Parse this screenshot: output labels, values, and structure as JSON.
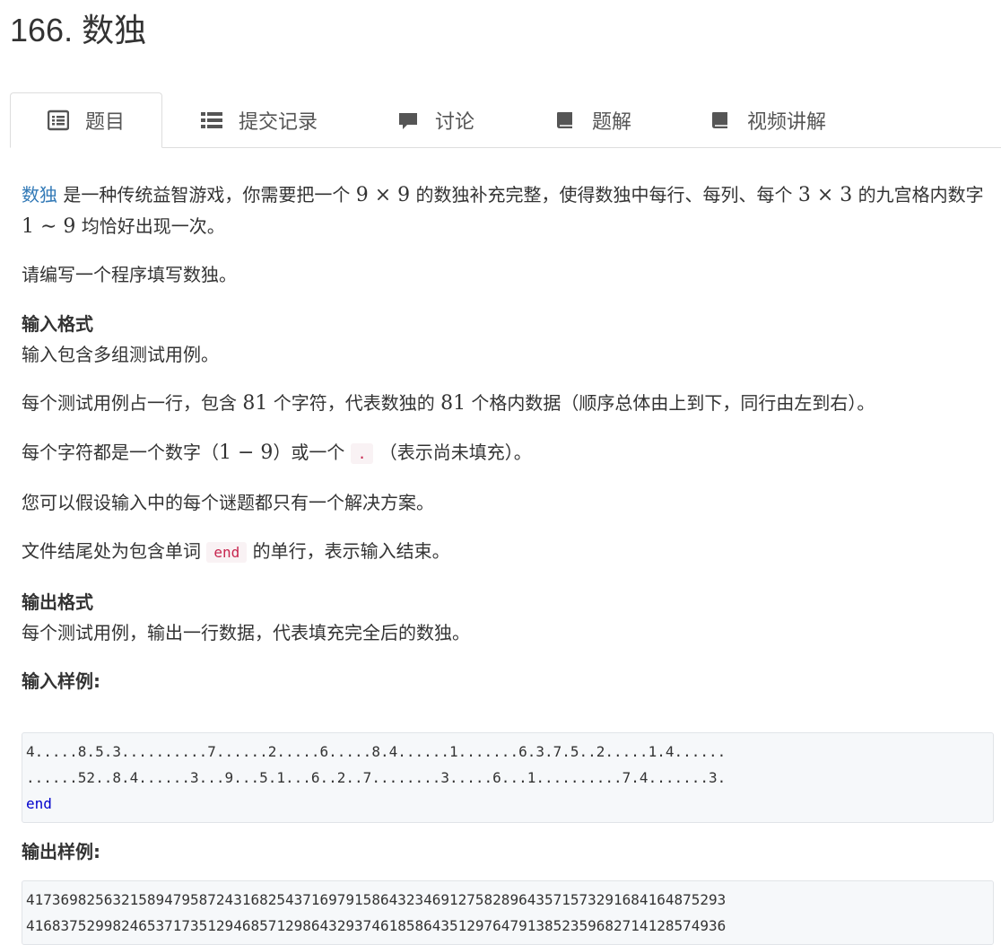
{
  "problem": {
    "title": "166. 数独"
  },
  "tabs": [
    {
      "label": "题目",
      "icon": "list-alt-icon",
      "active": true
    },
    {
      "label": "提交记录",
      "icon": "list-icon"
    },
    {
      "label": "讨论",
      "icon": "comment-icon"
    },
    {
      "label": "题解",
      "icon": "book-icon"
    },
    {
      "label": "视频讲解",
      "icon": "book-icon"
    }
  ],
  "intro": {
    "link": "数独",
    "t1": " 是一种传统益智游戏，你需要把一个 ",
    "m1": "9 × 9",
    "t2": " 的数独补充完整，使得数独中每行、每列、每个 ",
    "m2": "3 × 3",
    "t3": " 的九宫格内数字 ",
    "m3": "1 ∼ 9",
    "t4": " 均恰好出现一次。"
  },
  "p_task": "请编写一个程序填写数独。",
  "input_format": {
    "heading": "输入格式",
    "p1": "输入包含多组测试用例。",
    "p2a": "每个测试用例占一行，包含 ",
    "p2m": "81",
    "p2b": " 个字符，代表数独的 ",
    "p2m2": "81",
    "p2c": " 个格内数据（顺序总体由上到下，同行由左到右）。",
    "p3a": "每个字符都是一个数字（",
    "p3m": "1 − 9",
    "p3b": "）或一个 ",
    "p3code": ".",
    "p3c": " （表示尚未填充）。",
    "p4": "您可以假设输入中的每个谜题都只有一个解决方案。",
    "p5a": "文件结尾处为包含单词 ",
    "p5code": "end",
    "p5b": " 的单行，表示输入结束。"
  },
  "output_format": {
    "heading": "输出格式",
    "p1": "每个测试用例，输出一行数据，代表填充完全后的数独。"
  },
  "sample_input": {
    "heading": "输入样例:",
    "lines": [
      "4.....8.5.3..........7......2.....6.....8.4......1.......6.3.7.5..2.....1.4......",
      "......52..8.4......3...9...5.1...6..2..7........3.....6...1..........7.4.......3."
    ],
    "end": "end"
  },
  "sample_output": {
    "heading": "输出样例:",
    "lines": [
      "417369825632158947958724316825437169791586432346912758289643571573291684164875293",
      "416837529982465371735129468571298643293746185864351297647913852359682714128574936"
    ]
  },
  "colors": {
    "link": "#337ab7",
    "code_text": "#c7254e",
    "keyword": "#0000cc"
  }
}
